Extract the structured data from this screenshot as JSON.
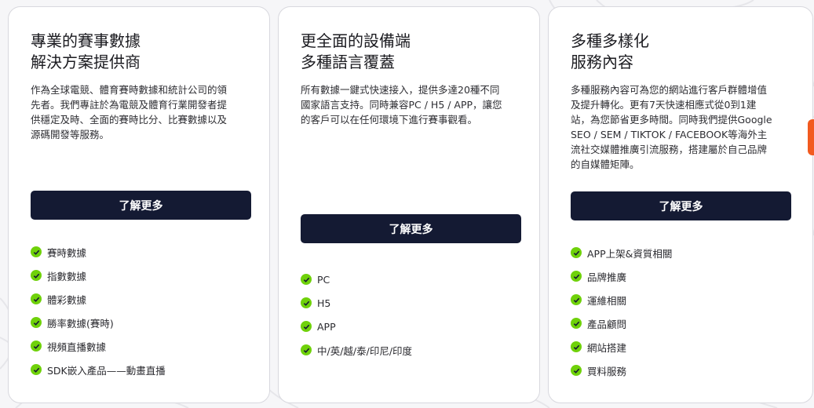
{
  "colors": {
    "accent_button": "#141a33",
    "check": "#6fd10a",
    "side_tab": "#f25a1f"
  },
  "cards": [
    {
      "title_lines": [
        "專業的賽事數據",
        "解決方案提供商"
      ],
      "description": "作為全球電競、體育賽時數據和統計公司的領先者。我們專註於為電競及體育行業開發者提供穩定及時、全面的賽時比分、比賽數據以及源碼開發等服務。",
      "button_label": "了解更多",
      "features": [
        "賽時數據",
        "指數數據",
        "體彩數據",
        "勝率數據(賽時)",
        "視頻直播數據",
        "SDK嵌入產品——動畫直播"
      ]
    },
    {
      "title_lines": [
        "更全面的設備端",
        "多種語言覆蓋"
      ],
      "description": "所有數據一鍵式快速接入，提供多達20種不同國家語言支持。同時兼容PC / H5 / APP，讓您的客戶可以在任何環境下進行賽事觀看。",
      "button_label": "了解更多",
      "features": [
        "PC",
        "H5",
        "APP",
        "中/英/越/泰/印尼/印度"
      ]
    },
    {
      "title_lines": [
        "多種多樣化",
        "服務內容"
      ],
      "description": "多種服務內容可為您的網站進行客戶群體增值及提升轉化。更有7天快速相應式從0到1建站，為您節省更多時間。同時我們提供Google SEO / SEM / TIKTOK / FACEBOOK等海外主流社交媒體推廣引流服務，搭建屬於自己品牌的自媒體矩陣。",
      "button_label": "了解更多",
      "features": [
        "APP上架&資質相關",
        "品牌推廣",
        "運維相關",
        "產品顧問",
        "網站搭建",
        "買料服務"
      ]
    }
  ]
}
